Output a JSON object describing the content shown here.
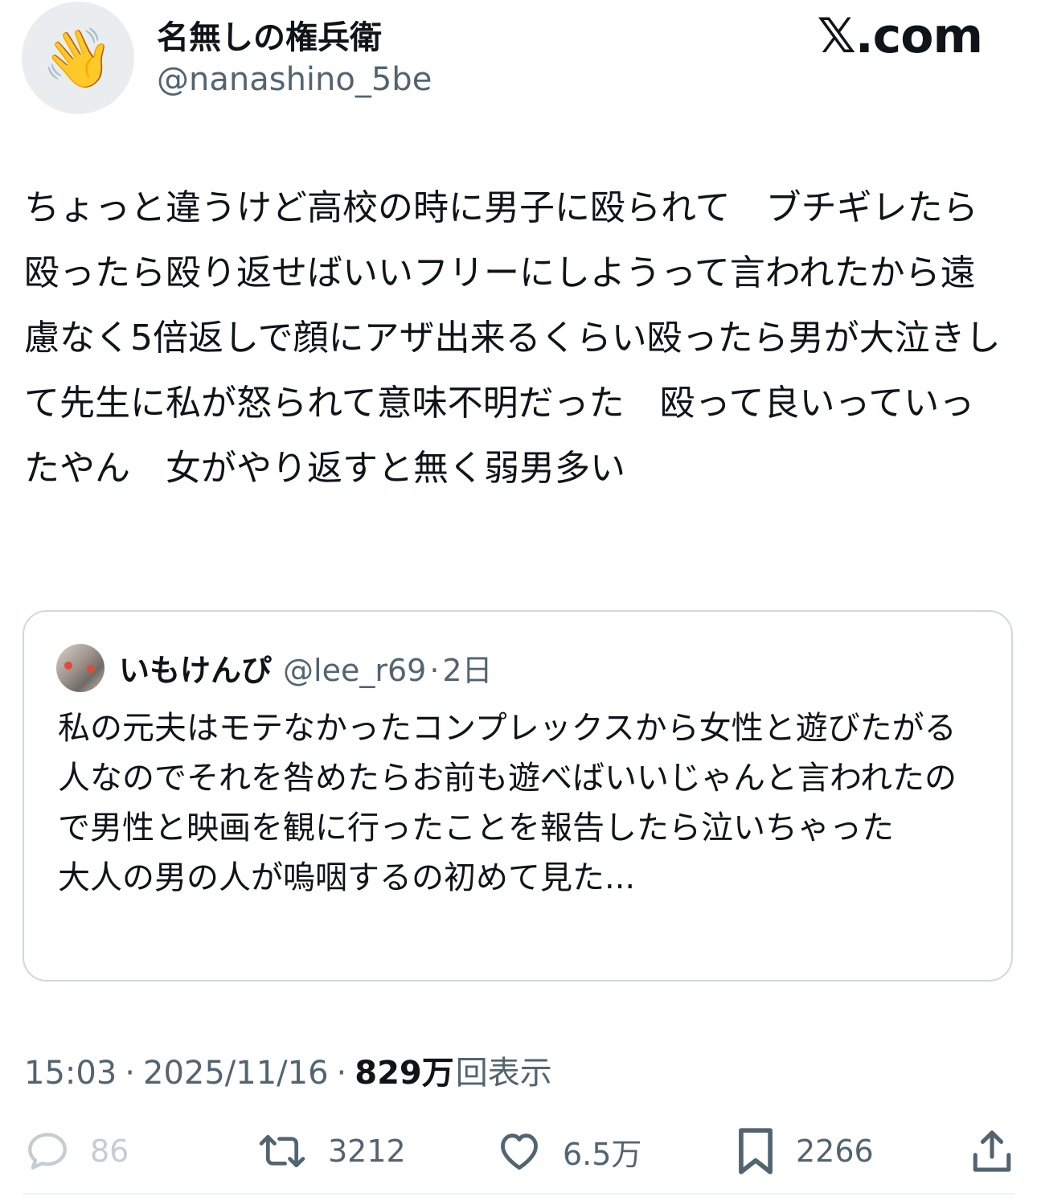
{
  "author": {
    "avatar_emoji": "👋",
    "display_name": "名無しの権兵衛",
    "handle": "@nanashino_5be"
  },
  "brand": "𝕏.com",
  "tweet": {
    "text": "ちょっと違うけど高校の時に男子に殴られて　ブチギレたら殴ったら殴り返せばいいフリーにしようって言われたから遠慮なく5倍返しで顔にアザ出来るくらい殴ったら男が大泣きして先生に私が怒られて意味不明だった　殴って良いっていったやん　女がやり返すと無く弱男多い"
  },
  "quote": {
    "display_name": "いもけんぴ",
    "handle": "@lee_r69",
    "separator": "·",
    "time": "2日",
    "text": "私の元夫はモテなかったコンプレックスから女性と遊びたがる人なのでそれを咎めたらお前も遊べばいいじゃんと言われたので男性と映画を観に行ったことを報告したら泣いちゃった\n大人の男の人が嗚咽するの初めて見た..."
  },
  "meta": {
    "time": "15:03",
    "sep1": "·",
    "date": "2025/11/16",
    "sep2": "·",
    "views_count": "829万",
    "views_label": "回表示"
  },
  "actions": {
    "reply": {
      "icon": "reply-icon",
      "count": "86"
    },
    "retweet": {
      "icon": "retweet-icon",
      "count": "3212"
    },
    "like": {
      "icon": "heart-icon",
      "count": "6.5万"
    },
    "bookmark": {
      "icon": "bookmark-icon",
      "count": "2266"
    },
    "share": {
      "icon": "share-icon"
    }
  },
  "colors": {
    "text_primary": "#0f1419",
    "text_secondary": "#536471",
    "border": "#cfd9de",
    "reply_muted": "#c4cdd4"
  }
}
